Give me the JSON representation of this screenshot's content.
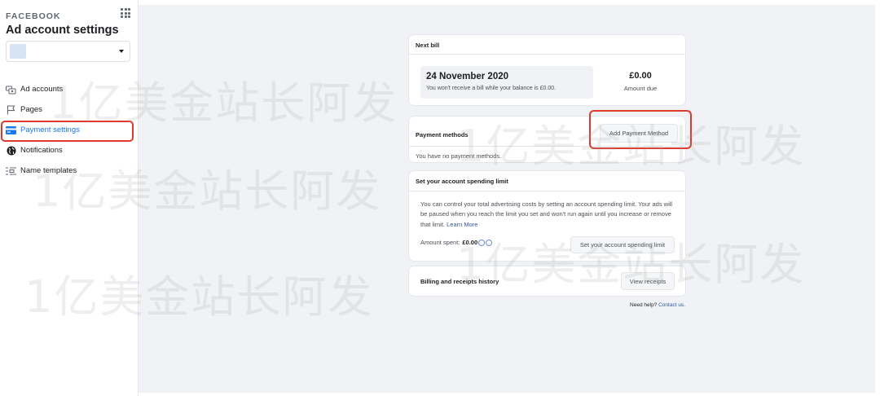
{
  "sidebar": {
    "brand": "FACEBOOK",
    "title": "Ad account settings",
    "account_selector": {
      "value": ""
    },
    "items": [
      {
        "label": "Ad accounts",
        "icon": "ad-accounts-icon"
      },
      {
        "label": "Pages",
        "icon": "flag-icon"
      },
      {
        "label": "Payment settings",
        "icon": "credit-card-icon",
        "active": true
      },
      {
        "label": "Notifications",
        "icon": "globe-icon"
      },
      {
        "label": "Name templates",
        "icon": "name-templates-icon"
      }
    ]
  },
  "next_bill": {
    "title": "Next bill",
    "date": "24 November 2020",
    "note": "You won't receive a bill while your balance is £0.00.",
    "amount": "£0.00",
    "amount_label": "Amount due"
  },
  "payment_methods": {
    "title": "Payment methods",
    "add_button": "Add Payment Method",
    "empty_text": "You have no payment methods."
  },
  "spending_limit": {
    "title": "Set your account spending limit",
    "description": "You can control your total advertising costs by setting an account spending limit. Your ads will be paused when you reach the limit you set and won't run again until you increase or remove that limit.",
    "learn_more": "Learn More",
    "amount_spent_label": "Amount spent:",
    "amount_spent_value": "£0.00",
    "button": "Set your account spending limit"
  },
  "billing_history": {
    "title": "Billing and receipts history",
    "button": "View receipts"
  },
  "footer": {
    "help_text": "Need help?",
    "contact_link": "Contact us."
  },
  "watermark": "1亿美金站长阿发",
  "colors": {
    "accent": "#1877f2",
    "highlight_border": "#e0392b",
    "main_background": "#f0f2f5"
  }
}
